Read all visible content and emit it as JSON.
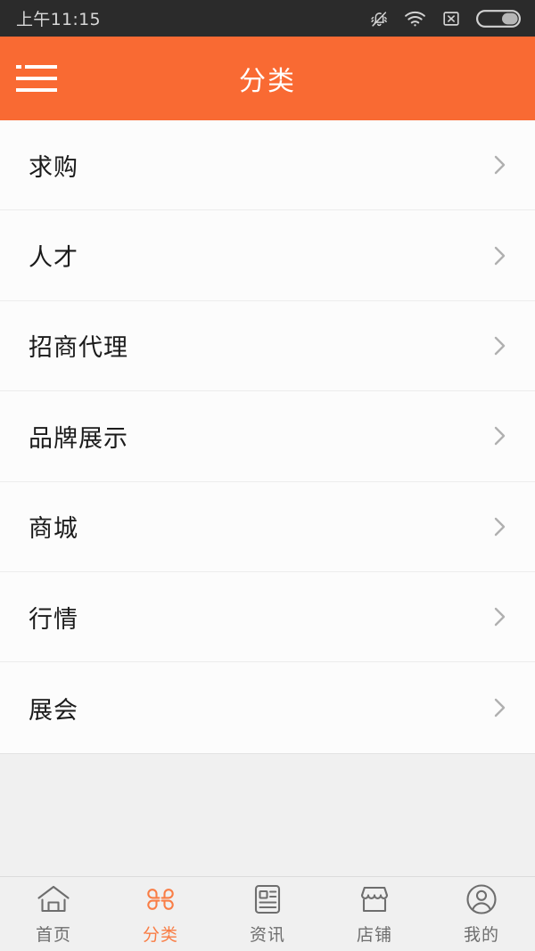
{
  "status_bar": {
    "time": "上午11:15",
    "icons": [
      {
        "name": "bell-muted-icon"
      },
      {
        "name": "wifi-icon"
      },
      {
        "name": "signal-off-icon"
      },
      {
        "name": "battery-icon"
      }
    ],
    "background": "#2b2b2b",
    "foreground": "#d6d6d6"
  },
  "header": {
    "title": "分类",
    "menu_icon": "hamburger-menu-icon",
    "background": "#f96a33",
    "foreground": "#ffffff"
  },
  "list": {
    "chevron_icon": "chevron-right-icon",
    "items": [
      {
        "label": "求购"
      },
      {
        "label": "人才"
      },
      {
        "label": "招商代理"
      },
      {
        "label": "品牌展示"
      },
      {
        "label": "商城"
      },
      {
        "label": "行情"
      },
      {
        "label": "展会"
      }
    ]
  },
  "tabbar": {
    "active_color": "#f97d45",
    "inactive_color": "#6e6e6e",
    "tabs": [
      {
        "label": "首页",
        "icon": "home-icon",
        "active": false
      },
      {
        "label": "分类",
        "icon": "category-icon",
        "active": true
      },
      {
        "label": "资讯",
        "icon": "news-icon",
        "active": false
      },
      {
        "label": "店铺",
        "icon": "shop-icon",
        "active": false
      },
      {
        "label": "我的",
        "icon": "profile-icon",
        "active": false
      }
    ]
  }
}
